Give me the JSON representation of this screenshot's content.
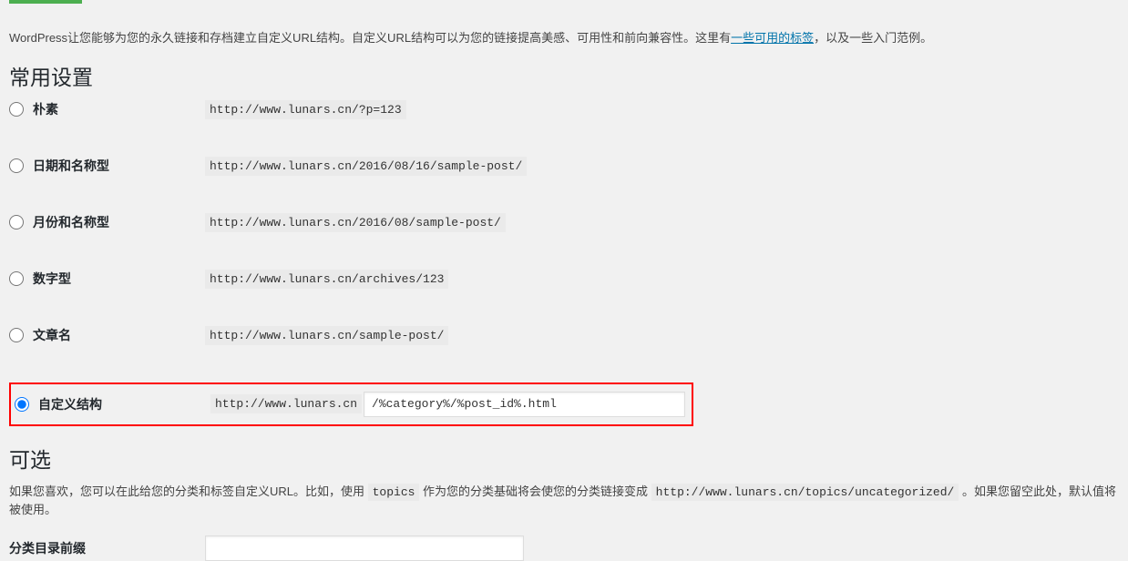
{
  "intro": {
    "pre": "WordPress让您能够为您的永久链接和存档建立自定义URL结构。自定义URL结构可以为您的链接提高美感、可用性和前向兼容性。这里有",
    "link": "一些可用的标签",
    "post": "，以及一些入门范例。"
  },
  "sections": {
    "common": "常用设置",
    "optional": "可选"
  },
  "options": {
    "plain": {
      "label": "朴素",
      "example": "http://www.lunars.cn/?p=123"
    },
    "date": {
      "label": "日期和名称型",
      "example": "http://www.lunars.cn/2016/08/16/sample-post/"
    },
    "month": {
      "label": "月份和名称型",
      "example": "http://www.lunars.cn/2016/08/sample-post/"
    },
    "numeric": {
      "label": "数字型",
      "example": "http://www.lunars.cn/archives/123"
    },
    "postname": {
      "label": "文章名",
      "example": "http://www.lunars.cn/sample-post/"
    },
    "custom": {
      "label": "自定义结构",
      "prefix": "http://www.lunars.cn",
      "value": "/%category%/%post_id%.html"
    }
  },
  "optional_text": {
    "t1": "如果您喜欢，您可以在此给您的分类和标签自定义URL。比如，使用 ",
    "code1": "topics",
    "t2": " 作为您的分类基础将会使您的分类链接变成 ",
    "code2": "http://www.lunars.cn/topics/uncategorized/",
    "t3": " 。如果您留空此处，默认值将被使用。"
  },
  "prefix": {
    "label": "分类目录前缀",
    "value": ""
  }
}
